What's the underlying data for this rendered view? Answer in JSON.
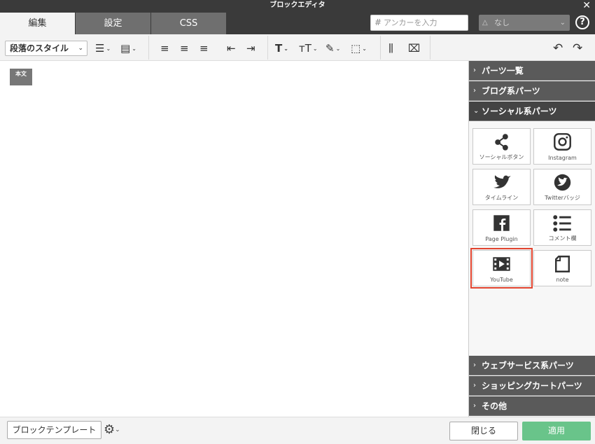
{
  "window": {
    "title": "ブロックエディタ",
    "close_glyph": "✕"
  },
  "tabs": [
    {
      "label": "編集",
      "active": true
    },
    {
      "label": "設定",
      "active": false
    },
    {
      "label": "CSS",
      "active": false
    }
  ],
  "anchor": {
    "placeholder": "アンカーを入力",
    "hash": "#"
  },
  "select": {
    "value": "なし"
  },
  "help_glyph": "?",
  "toolbar": {
    "paragraph_style": "段落のスタイル"
  },
  "editor": {
    "block_tag": "本文"
  },
  "sidebar": {
    "sections_top": [
      {
        "label": "パーツ一覧",
        "open": false
      },
      {
        "label": "ブログ系パーツ",
        "open": false
      },
      {
        "label": "ソーシャル系パーツ",
        "open": true
      }
    ],
    "parts": [
      {
        "label": "ソーシャルボタン",
        "icon": "share-icon"
      },
      {
        "label": "Instagram",
        "icon": "instagram-icon"
      },
      {
        "label": "タイムライン",
        "icon": "twitter-bird-icon"
      },
      {
        "label": "Twitterバッジ",
        "icon": "twitter-badge-icon"
      },
      {
        "label": "Page Plugin",
        "icon": "facebook-icon"
      },
      {
        "label": "コメント欄",
        "icon": "list-icon"
      },
      {
        "label": "YouTube",
        "icon": "film-icon",
        "selected": true
      },
      {
        "label": "note",
        "icon": "note-icon"
      }
    ],
    "sections_bottom": [
      {
        "label": "ウェブサービス系パーツ"
      },
      {
        "label": "ショッピングカートパーツ"
      },
      {
        "label": "その他"
      }
    ]
  },
  "footer": {
    "template_button": "ブロックテンプレート",
    "close_button": "閉じる",
    "apply_button": "適用"
  },
  "colors": {
    "selected_outline": "#e2442f",
    "apply_button": "#69c48a",
    "dark_bar": "#3a3a3a"
  }
}
